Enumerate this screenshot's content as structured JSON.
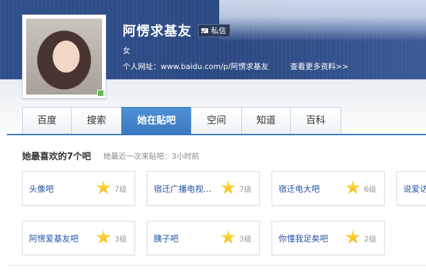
{
  "profile": {
    "username": "阿愣求基友",
    "message_label": "私信",
    "gender": "女",
    "url_label": "个人网址：",
    "url_value": "www.baidu.com/p/阿愣求基友",
    "more_link": "查看更多资料>>"
  },
  "tabs": [
    {
      "label": "百度"
    },
    {
      "label": "搜索"
    },
    {
      "label": "她在贴吧",
      "active": true
    },
    {
      "label": "空间"
    },
    {
      "label": "知道"
    },
    {
      "label": "百科"
    }
  ],
  "favorites": {
    "title": "她最喜欢的7个吧",
    "subtitle": "她最近一次来贴吧：3小时前",
    "items": [
      {
        "name": "头像吧",
        "level": "7级"
      },
      {
        "name": "宿迁广播电视...",
        "level": "7级"
      },
      {
        "name": "宿迁电大吧",
        "level": "6级"
      },
      {
        "name": "说爱访",
        "level": ""
      },
      {
        "name": "阿愣爱基友吧",
        "level": "3级"
      },
      {
        "name": "胰子吧",
        "level": "3级"
      },
      {
        "name": "你懂我足矣吧",
        "level": "2级"
      }
    ]
  },
  "colors": {
    "banner": "#2c4982",
    "active_tab": "#3a78bf",
    "link": "#2653a5",
    "online": "#5cc04a"
  },
  "icons": [
    "mail-icon",
    "star-icon",
    "online-status-icon"
  ]
}
